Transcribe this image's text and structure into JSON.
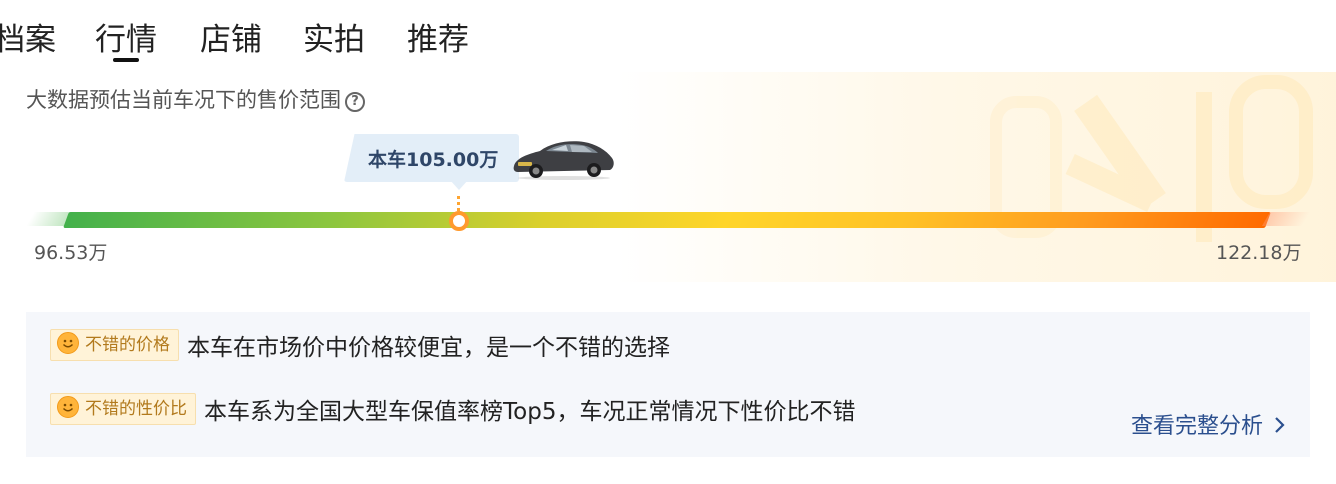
{
  "tabs": [
    {
      "label": "档案"
    },
    {
      "label": "行情"
    },
    {
      "label": "店铺"
    },
    {
      "label": "实拍"
    },
    {
      "label": "推荐"
    }
  ],
  "active_tab": "行情",
  "price_panel": {
    "title": "大数据预估当前车况下的售价范围",
    "help_icon": "help-circle-icon",
    "current_label": "本车105.00万",
    "current_value": 105.0,
    "min_label": "96.53万",
    "max_label": "122.18万",
    "min_value": 96.53,
    "max_value": 122.18,
    "colors": {
      "low": "#43b14b",
      "mid": "#ffd52a",
      "high": "#ff6a00",
      "marker": "#ff9a2e",
      "bubble_text": "#2f4668"
    }
  },
  "evaluation": {
    "items": [
      {
        "badge": "不错的价格",
        "icon": "smile-icon",
        "text": "本车在市场价中价格较便宜，是一个不错的选择"
      },
      {
        "badge": "不错的性价比",
        "icon": "smile-icon",
        "text": "本车系为全国大型车保值率榜Top5，车况正常情况下性价比不错"
      }
    ],
    "link_label": "查看完整分析",
    "link_color": "#2b4f8e"
  }
}
